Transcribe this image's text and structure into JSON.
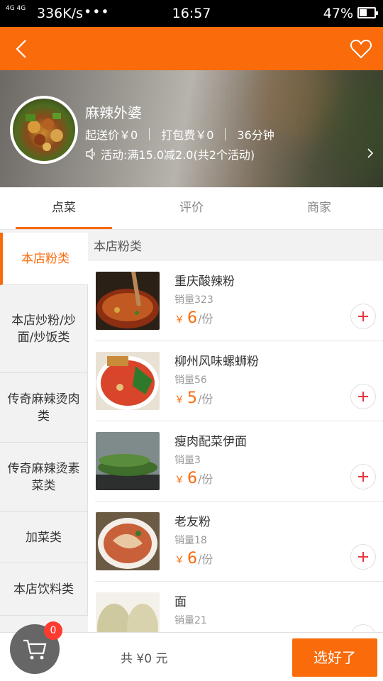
{
  "status_bar": {
    "network": "4G 4G",
    "speed": "336K/s",
    "dots": "•••",
    "time": "16:57",
    "battery": "47%",
    "battery_level": 0.47
  },
  "title_bar": {
    "back_icon": "chevron-left-icon",
    "favorite_icon": "heart-outline-icon"
  },
  "shop": {
    "name": "麻辣外婆",
    "min_price": "起送价￥0",
    "packing_fee": "打包费￥0",
    "delivery_time": "36分钟",
    "promo": "活动:满15.0减2.0(共2个活动)"
  },
  "tabs": [
    {
      "label": "点菜",
      "active": true
    },
    {
      "label": "评价",
      "active": false
    },
    {
      "label": "商家",
      "active": false
    }
  ],
  "categories": [
    {
      "label": "本店粉类",
      "active": true
    },
    {
      "label": "本店炒粉/炒面/炒饭类",
      "active": false
    },
    {
      "label": "传奇麻辣烫肉类",
      "active": false
    },
    {
      "label": "传奇麻辣烫素菜类",
      "active": false
    },
    {
      "label": "加菜类",
      "active": false
    },
    {
      "label": "本店饮料类",
      "active": false
    }
  ],
  "section_title": "本店粉类",
  "items": [
    {
      "name": "重庆酸辣粉",
      "sales": "销量323",
      "currency": "￥",
      "price": "6",
      "unit": "/份"
    },
    {
      "name": "柳州风味螺蛳粉",
      "sales": "销量56",
      "currency": "￥",
      "price": "5",
      "unit": "/份"
    },
    {
      "name": "瘦肉配菜伊面",
      "sales": "销量3",
      "currency": "￥",
      "price": "6",
      "unit": "/份"
    },
    {
      "name": "老友粉",
      "sales": "销量18",
      "currency": "￥",
      "price": "6",
      "unit": "/份"
    },
    {
      "name": "面",
      "sales": "销量21",
      "currency": "￥",
      "price": "",
      "unit": ""
    }
  ],
  "bottom": {
    "cart_count": "0",
    "total": "共 ¥0 元",
    "submit": "选好了"
  },
  "colors": {
    "accent": "#f96b0b",
    "badge": "#ff3b30"
  }
}
